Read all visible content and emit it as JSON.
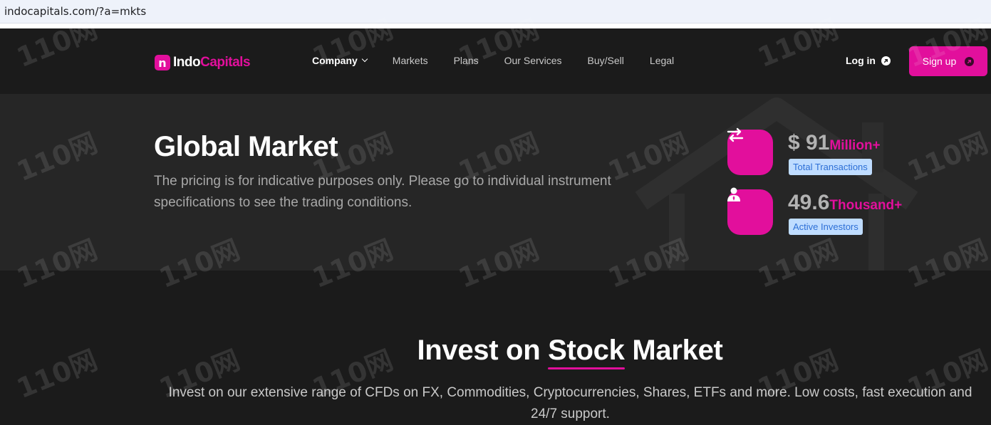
{
  "browser": {
    "url": "indocapitals.com/?a=mkts"
  },
  "brand": {
    "logo_letter": "n",
    "name_part1": "Indo",
    "name_part2": "Capitals",
    "accent_color": "#e20f9c"
  },
  "nav": {
    "links": [
      {
        "label": "Company",
        "active": true,
        "has_dropdown": true
      },
      {
        "label": "Markets"
      },
      {
        "label": "Plans"
      },
      {
        "label": "Our Services"
      },
      {
        "label": "Buy/Sell"
      },
      {
        "label": "Legal"
      }
    ],
    "login_label": "Log in",
    "signup_label": "Sign up"
  },
  "hero": {
    "title": "Global Market",
    "description": "The pricing is for indicative purposes only. Please go to individual instrument specifications to see the trading conditions.",
    "stats": [
      {
        "value": "$ 91",
        "suffix": "Million+",
        "label": "Total Transactions",
        "icon": "transfer-arrows-icon"
      },
      {
        "value": "49.6",
        "suffix": "Thousand+",
        "label": "Active Investors",
        "icon": "investor-person-icon"
      }
    ]
  },
  "section": {
    "title_before": "Invest on ",
    "title_highlight": "Stock",
    "title_after": " Market",
    "description": "Invest on our extensive range of CFDs on FX, Commodities, Cryptocurrencies, Shares, ETFs and more. Low costs, fast execution and 24/7 support."
  },
  "watermark": {
    "text": "110网"
  }
}
